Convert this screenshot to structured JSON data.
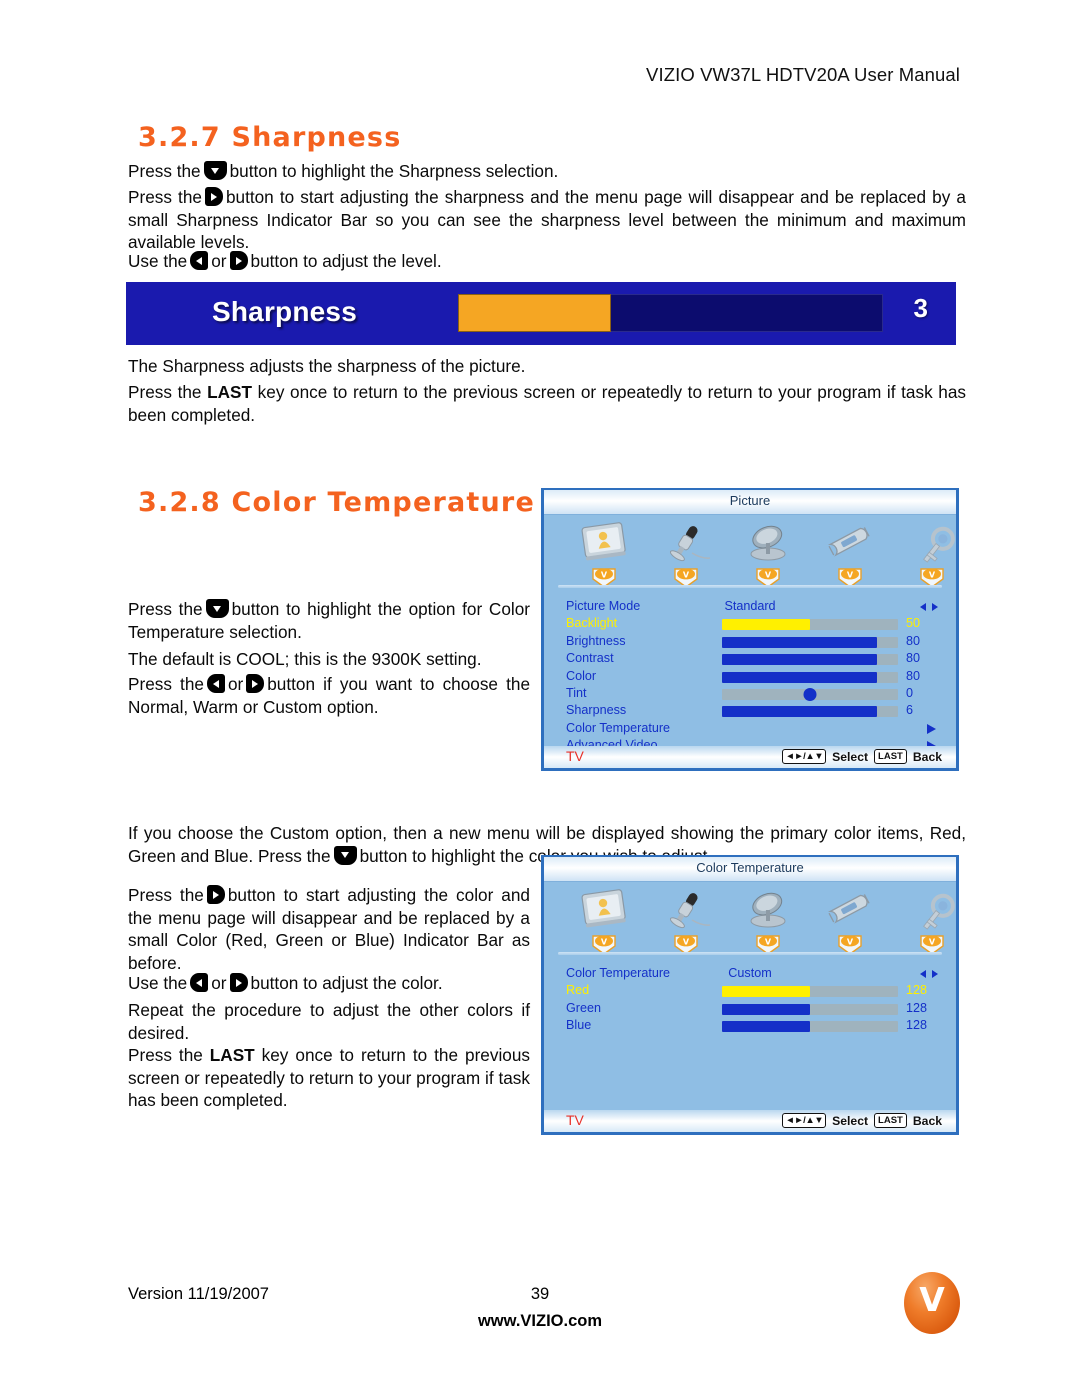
{
  "header": {
    "manual_title": "VIZIO VW37L HDTV20A User Manual"
  },
  "section_sharpness": {
    "heading": "3.2.7 Sharpness",
    "p1_a": "Press the",
    "p1_b": "button to highlight the Sharpness selection.",
    "p2_a": "Press the",
    "p2_b": "button to start adjusting the sharpness and the menu page will disappear and be replaced by a small Sharpness Indicator Bar so you can see the sharpness level between the minimum and maximum available levels.",
    "p3_a": "Use the",
    "p3_or": "or",
    "p3_b": "button to adjust the level.",
    "p4": "The Sharpness adjusts the sharpness of the picture.",
    "p5_a": "Press the",
    "p5_key": "LAST",
    "p5_b": "key once to return to the previous screen or repeatedly to return to your program if task has been completed."
  },
  "sharpness_bar": {
    "label": "Sharpness",
    "value": "3",
    "fill_percent": 36,
    "background_color": "#1A1AAE",
    "fill_color": "#F5A623",
    "track_color": "#0C0C6E"
  },
  "section_color_temperature": {
    "heading": "3.2.8 Color Temperature",
    "p1_a": "Press the",
    "p1_b": "button to highlight the option for Color Temperature selection.",
    "p2": "The default is COOL; this is the 9300K setting.",
    "p3_a": "Press the",
    "p3_or": "or",
    "p3_b": "button if you want to choose the Normal, Warm or Custom option.",
    "p4_a": "If you choose the Custom option, then a new menu will be displayed showing the primary color items, Red, Green and Blue.  Press the",
    "p4_b": "button to highlight the color you wish to adjust.",
    "p5_a": "Press the",
    "p5_b": "button to start adjusting the color and the menu page will disappear and be replaced by a small Color (Red, Green or Blue) Indicator Bar as before.",
    "p6_a": "Use the",
    "p6_or": "or",
    "p6_b": "button to adjust the color.",
    "p7": "Repeat the procedure to adjust the other colors if desired.",
    "p8_a": "Press the",
    "p8_key": "LAST",
    "p8_b": "key once to return to the previous screen or repeatedly to return to your program if task has been completed."
  },
  "osd_picture": {
    "title": "Picture",
    "icons": [
      {
        "name": "picture-screen-icon"
      },
      {
        "name": "microphone-icon"
      },
      {
        "name": "satellite-dish-icon"
      },
      {
        "name": "wrench-icon"
      },
      {
        "name": "key-icon"
      }
    ],
    "rows": [
      {
        "label": "Picture Mode",
        "value_text": "Standard",
        "control": "lr-arrows",
        "highlighted": false
      },
      {
        "label": "Backlight",
        "number": "50",
        "fill": 50,
        "control": "slider",
        "highlighted": true
      },
      {
        "label": "Brightness",
        "number": "80",
        "fill": 88,
        "control": "slider",
        "highlighted": false
      },
      {
        "label": "Contrast",
        "number": "80",
        "fill": 88,
        "control": "slider",
        "highlighted": false
      },
      {
        "label": "Color",
        "number": "80",
        "fill": 88,
        "control": "slider",
        "highlighted": false
      },
      {
        "label": "Tint",
        "number": "0",
        "dot": 50,
        "control": "dot-slider",
        "highlighted": false
      },
      {
        "label": "Sharpness",
        "number": "6",
        "fill": 88,
        "control": "slider",
        "highlighted": false
      },
      {
        "label": "Color Temperature",
        "control": "right-arrow",
        "highlighted": false
      },
      {
        "label": "Advanced Video",
        "control": "right-arrow",
        "highlighted": false
      }
    ],
    "footer": {
      "source": "TV",
      "nav_keycap": "◄►/▲▼",
      "select_label": "Select",
      "last_keycap": "LAST",
      "back_label": "Back"
    }
  },
  "osd_color_temperature": {
    "title": "Color Temperature",
    "icons": [
      {
        "name": "picture-screen-icon"
      },
      {
        "name": "microphone-icon"
      },
      {
        "name": "satellite-dish-icon"
      },
      {
        "name": "wrench-icon"
      },
      {
        "name": "key-icon"
      }
    ],
    "rows": [
      {
        "label": "Color Temperature",
        "value_text": "Custom",
        "control": "lr-arrows",
        "highlighted": false
      },
      {
        "label": "Red",
        "number": "128",
        "fill": 50,
        "control": "slider",
        "highlighted": true
      },
      {
        "label": "Green",
        "number": "128",
        "fill": 50,
        "control": "slider",
        "highlighted": false
      },
      {
        "label": "Blue",
        "number": "128",
        "fill": 50,
        "control": "slider",
        "highlighted": false
      }
    ],
    "footer": {
      "source": "TV",
      "nav_keycap": "◄►/▲▼",
      "select_label": "Select",
      "last_keycap": "LAST",
      "back_label": "Back"
    }
  },
  "footer": {
    "version": "Version 11/19/2007",
    "page_number": "39",
    "website": "www.VIZIO.com",
    "logo_letter": "V"
  },
  "colors": {
    "heading_orange": "#F4621F",
    "osd_background": "#8FBEE4",
    "osd_text_blue": "#1430C8",
    "osd_highlight_yellow": "#FFF000",
    "osd_source_red": "#E8312A",
    "logo_orange": "#EF7C2A"
  }
}
